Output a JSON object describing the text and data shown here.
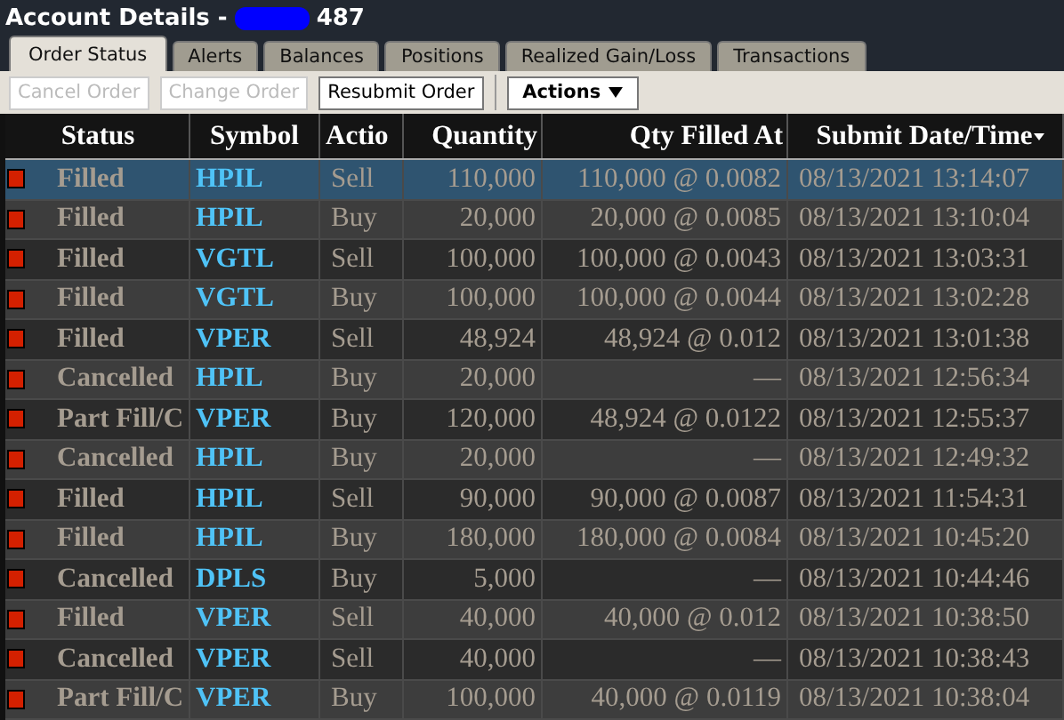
{
  "window": {
    "title": "Account Details -",
    "account_suffix": "487"
  },
  "tabs": [
    {
      "label": "Order Status",
      "selected": true
    },
    {
      "label": "Alerts",
      "selected": false
    },
    {
      "label": "Balances",
      "selected": false
    },
    {
      "label": "Positions",
      "selected": false
    },
    {
      "label": "Realized Gain/Loss",
      "selected": false
    },
    {
      "label": "Transactions",
      "selected": false
    }
  ],
  "toolbar": {
    "buttons": [
      {
        "label": "Cancel Order",
        "disabled": true
      },
      {
        "label": "Change Order",
        "disabled": true
      },
      {
        "label": "Resubmit Order",
        "disabled": false
      }
    ],
    "menu": {
      "label": "Actions"
    }
  },
  "table": {
    "columns": [
      "Status",
      "Symbol",
      "Actio",
      "Quantity",
      "Qty Filled At",
      "Submit Date/Time"
    ],
    "rows": [
      {
        "selected": true,
        "cells": [
          "Filled",
          "HPIL",
          "Sell",
          "110,000",
          "110,000 @ 0.0082",
          "08/13/2021 13:14:07"
        ]
      },
      {
        "selected": false,
        "cells": [
          "Filled",
          "HPIL",
          "Buy",
          "20,000",
          "20,000 @ 0.0085",
          "08/13/2021 13:10:04"
        ]
      },
      {
        "selected": false,
        "cells": [
          "Filled",
          "VGTL",
          "Sell",
          "100,000",
          "100,000 @ 0.0043",
          "08/13/2021 13:03:31"
        ]
      },
      {
        "selected": false,
        "cells": [
          "Filled",
          "VGTL",
          "Buy",
          "100,000",
          "100,000 @ 0.0044",
          "08/13/2021 13:02:28"
        ]
      },
      {
        "selected": false,
        "cells": [
          "Filled",
          "VPER",
          "Sell",
          "48,924",
          "48,924 @ 0.012",
          "08/13/2021 13:01:38"
        ]
      },
      {
        "selected": false,
        "cells": [
          "Cancelled",
          "HPIL",
          "Buy",
          "20,000",
          "—",
          "08/13/2021 12:56:34"
        ]
      },
      {
        "selected": false,
        "cells": [
          "Part Fill/C",
          "VPER",
          "Buy",
          "120,000",
          "48,924 @ 0.0122",
          "08/13/2021 12:55:37"
        ]
      },
      {
        "selected": false,
        "cells": [
          "Cancelled",
          "HPIL",
          "Buy",
          "20,000",
          "—",
          "08/13/2021 12:49:32"
        ]
      },
      {
        "selected": false,
        "cells": [
          "Filled",
          "HPIL",
          "Sell",
          "90,000",
          "90,000 @ 0.0087",
          "08/13/2021 11:54:31"
        ]
      },
      {
        "selected": false,
        "cells": [
          "Filled",
          "HPIL",
          "Buy",
          "180,000",
          "180,000 @ 0.0084",
          "08/13/2021 10:45:20"
        ]
      },
      {
        "selected": false,
        "cells": [
          "Cancelled",
          "DPLS",
          "Buy",
          "5,000",
          "—",
          "08/13/2021 10:44:46"
        ]
      },
      {
        "selected": false,
        "cells": [
          "Filled",
          "VPER",
          "Sell",
          "40,000",
          "40,000 @ 0.012",
          "08/13/2021 10:38:50"
        ]
      },
      {
        "selected": false,
        "cells": [
          "Cancelled",
          "VPER",
          "Sell",
          "40,000",
          "—",
          "08/13/2021 10:38:43"
        ]
      },
      {
        "selected": false,
        "cells": [
          "Part Fill/C",
          "VPER",
          "Buy",
          "100,000",
          "40,000 @ 0.0119",
          "08/13/2021 10:38:04"
        ]
      }
    ]
  }
}
